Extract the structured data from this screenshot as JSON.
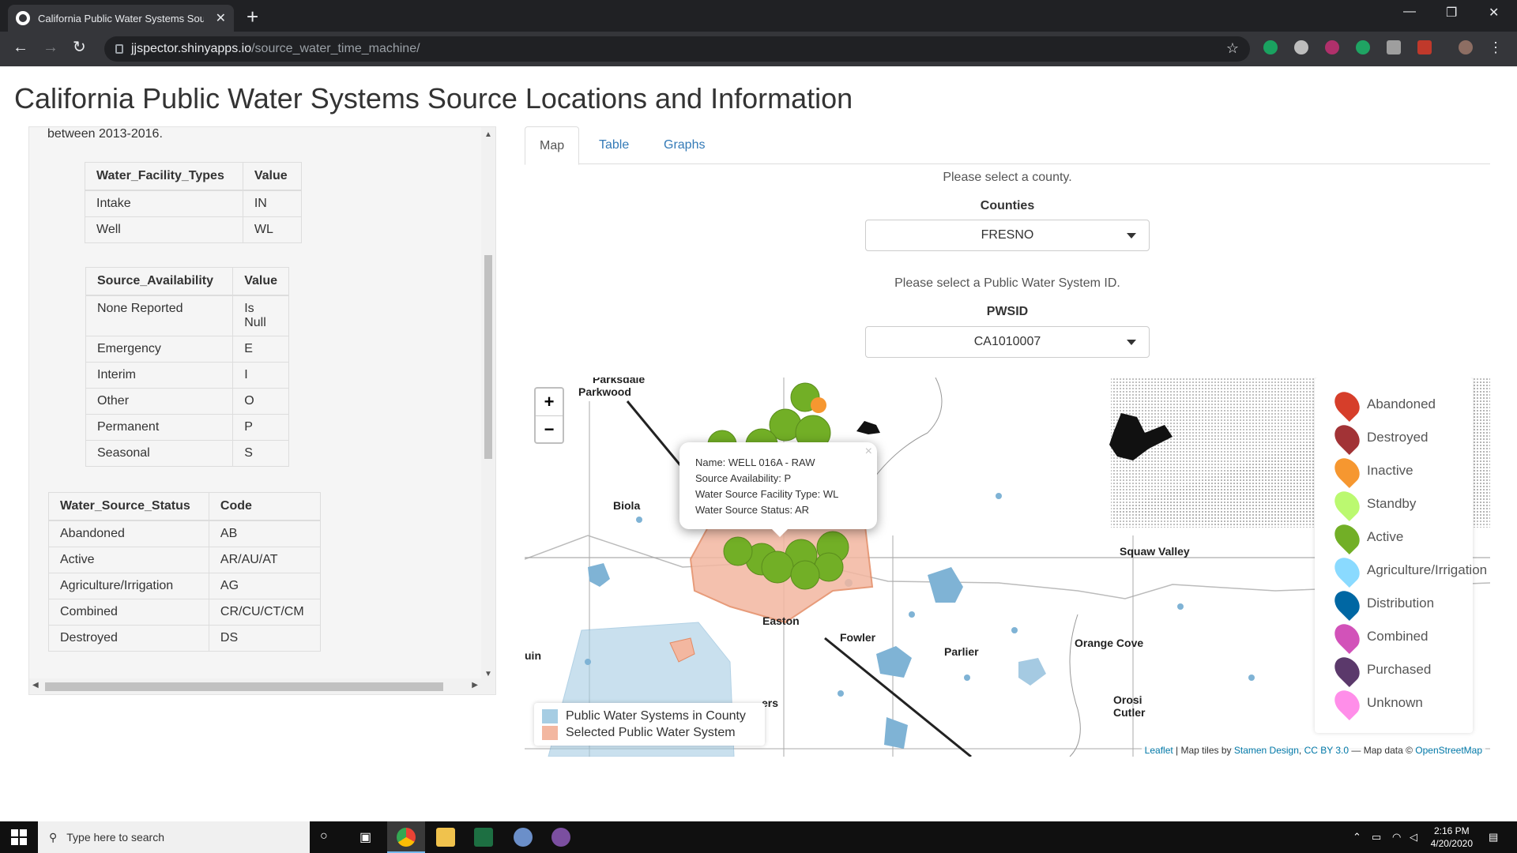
{
  "browser": {
    "tab_title": "California Public Water Systems Source",
    "new_tab": "+",
    "url_host": "jjspector.shinyapps.io",
    "url_path": "/source_water_time_machine/"
  },
  "page": {
    "title": "California Public Water Systems Source Locations and Information",
    "side_intro": "between 2013-2016.",
    "facility_table": {
      "headers": [
        "Water_Facility_Types",
        "Value"
      ],
      "rows": [
        [
          "Intake",
          "IN"
        ],
        [
          "Well",
          "WL"
        ]
      ]
    },
    "availability_table": {
      "headers": [
        "Source_Availability",
        "Value"
      ],
      "rows": [
        [
          "None Reported",
          "Is Null"
        ],
        [
          "Emergency",
          "E"
        ],
        [
          "Interim",
          "I"
        ],
        [
          "Other",
          "O"
        ],
        [
          "Permanent",
          "P"
        ],
        [
          "Seasonal",
          "S"
        ]
      ]
    },
    "status_table": {
      "headers": [
        "Water_Source_Status",
        "Code"
      ],
      "rows": [
        [
          "Abandoned",
          "AB"
        ],
        [
          "Active",
          "AR/AU/AT"
        ],
        [
          "Agriculture/Irrigation",
          "AG"
        ],
        [
          "Combined",
          "CR/CU/CT/CM"
        ],
        [
          "Destroyed",
          "DS"
        ]
      ]
    },
    "tabs": [
      "Map",
      "Table",
      "Graphs"
    ],
    "county_prompt": "Please select a county.",
    "county_label": "Counties",
    "county_value": "FRESNO",
    "pwsid_prompt": "Please select a Public Water System ID.",
    "pwsid_label": "PWSID",
    "pwsid_value": "CA1010007"
  },
  "map": {
    "zoom_in": "+",
    "zoom_out": "−",
    "places": [
      "Parksdale",
      "Parkwood",
      "Biola",
      "Squaw Valley",
      "Easton",
      "Fowler",
      "Parlier",
      "Orange Cove",
      "Orosi",
      "Cutler",
      "uin",
      "ers"
    ],
    "popup": {
      "name": "Name: WELL 016A - RAW",
      "availability": "Source Availability: P",
      "facility_type": "Water Source Facility Type: WL",
      "status": "Water Source Status: AR",
      "close": "×"
    },
    "legend": [
      {
        "label": "Abandoned",
        "color": "#d63e2a"
      },
      {
        "label": "Destroyed",
        "color": "#a23336"
      },
      {
        "label": "Inactive",
        "color": "#f69730"
      },
      {
        "label": "Standby",
        "color": "#bbf970"
      },
      {
        "label": "Active",
        "color": "#72af26"
      },
      {
        "label": "Agriculture/Irrigation",
        "color": "#8adaff"
      },
      {
        "label": "Distribution",
        "color": "#0067a3"
      },
      {
        "label": "Combined",
        "color": "#d252b9"
      },
      {
        "label": "Purchased",
        "color": "#5b396b"
      },
      {
        "label": "Unknown",
        "color": "#ff8ee9"
      }
    ],
    "bottom_legend": [
      {
        "label": "Public Water Systems in County",
        "color": "#a6cde3"
      },
      {
        "label": "Selected Public Water System",
        "color": "#f3b7a0"
      }
    ],
    "attribution": {
      "leaflet": "Leaflet",
      "sep1": " | Map tiles by ",
      "stamen": "Stamen Design",
      "sep2": ", ",
      "cc": "CC BY 3.0",
      "sep3": " — Map data © ",
      "osm": "OpenStreetMap"
    }
  },
  "taskbar": {
    "search_placeholder": "Type here to search",
    "time": "2:16 PM",
    "date": "4/20/2020"
  }
}
